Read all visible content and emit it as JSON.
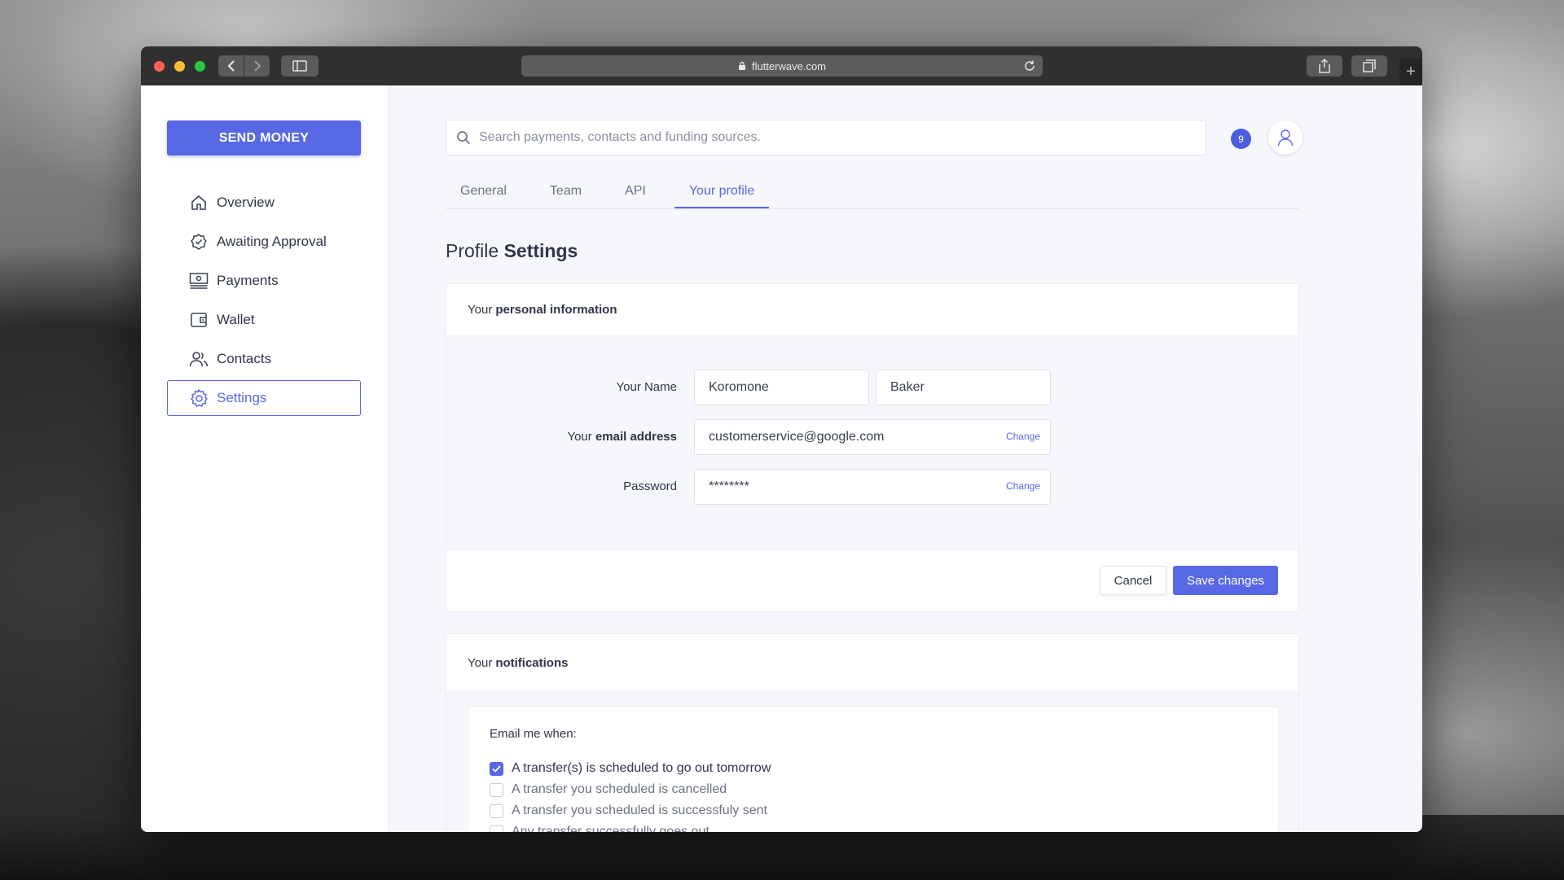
{
  "browser": {
    "url": "flutterwave.com"
  },
  "sidebar": {
    "send_money_label": "SEND MONEY",
    "items": [
      {
        "label": "Overview",
        "icon": "home-icon"
      },
      {
        "label": "Awaiting Approval",
        "icon": "check-badge-icon"
      },
      {
        "label": "Payments",
        "icon": "payments-icon"
      },
      {
        "label": "Wallet",
        "icon": "wallet-icon"
      },
      {
        "label": "Contacts",
        "icon": "contacts-icon"
      },
      {
        "label": "Settings",
        "icon": "gear-icon",
        "active": true
      }
    ]
  },
  "header": {
    "search_placeholder": "Search payments, contacts and funding sources.",
    "notification_count": "9"
  },
  "tabs": [
    {
      "label": "General"
    },
    {
      "label": "Team"
    },
    {
      "label": "API"
    },
    {
      "label": "Your profile",
      "active": true
    }
  ],
  "page": {
    "title_prefix": "Profile",
    "title_bold": "Settings"
  },
  "personal": {
    "heading_prefix": "Your",
    "heading_bold": "personal information",
    "name_label": "Your Name",
    "first_name": "Koromone",
    "last_name": "Baker",
    "email_label_prefix": "Your",
    "email_label_bold": "email address",
    "email_value": "customerservice@google.com",
    "email_change": "Change",
    "password_label": "Password",
    "password_value": "********",
    "password_change": "Change",
    "cancel_label": "Cancel",
    "save_label": "Save changes"
  },
  "notifications": {
    "heading_prefix": "Your",
    "heading_bold": "notifications",
    "email_heading": "Email me when:",
    "options": [
      {
        "label": "A transfer(s) is scheduled to go out tomorrow",
        "checked": true
      },
      {
        "label": "A transfer you scheduled is cancelled",
        "checked": false
      },
      {
        "label": "A transfer you scheduled is successfuly sent",
        "checked": false
      },
      {
        "label": "Any transfer successfully goes out",
        "checked": false
      }
    ]
  },
  "colors": {
    "accent": "#5768e4",
    "text": "#2f3649",
    "muted": "#6c7283",
    "panel_bg": "#f6f7fb"
  }
}
